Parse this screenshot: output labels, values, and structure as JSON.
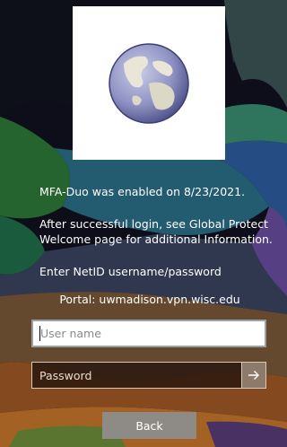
{
  "messages": {
    "mfa_notice": "MFA-Duo was enabled on 8/23/2021.",
    "login_info": "After successful login, see Global Protect Welcome page for additional Information.",
    "enter_prompt": "Enter NetID username/password",
    "portal": "Portal: uwmadison.vpn.wisc.edu"
  },
  "form": {
    "username_placeholder": "User name",
    "username_value": "",
    "password_placeholder": "Password",
    "password_value": "",
    "submit_icon": "arrow-right-icon",
    "back_label": "Back"
  },
  "logo": {
    "icon": "globe-icon"
  },
  "colors": {
    "logo_background": "#ffffff",
    "input_background": "#ffffff",
    "password_background": "#28160e",
    "submit_button": "#8d7a6a",
    "back_button": "#8e8b86",
    "text": "#ffffff"
  }
}
